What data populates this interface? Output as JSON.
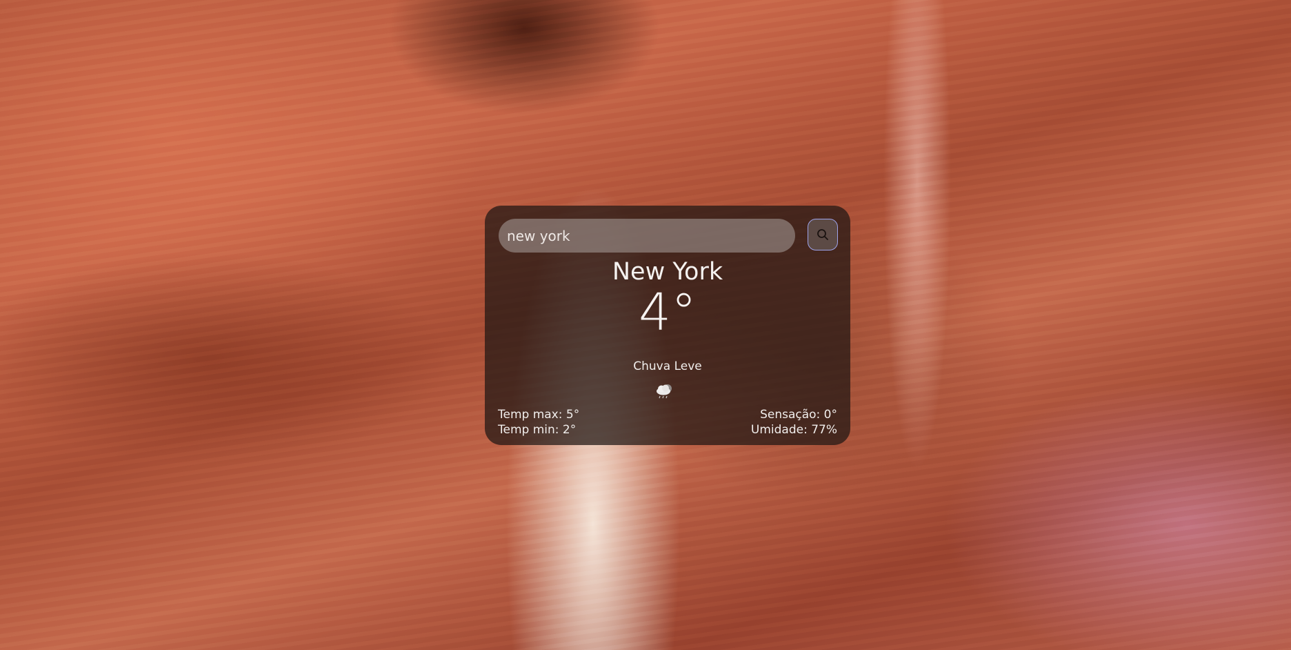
{
  "search": {
    "value": "new york",
    "button_icon": "search-icon"
  },
  "weather": {
    "city": "New York",
    "temperature": "4°",
    "description": "Chuva Leve",
    "icon": "cloud-rain-icon",
    "temp_max": "Temp max: 5°",
    "temp_min": "Temp min: 2°",
    "feels_like": "Sensação: 0°",
    "humidity": "Umidade: 77%"
  },
  "colors": {
    "card_background": "#1e1614",
    "button_border": "#9da3ea",
    "button_background": "#5c4a45"
  }
}
